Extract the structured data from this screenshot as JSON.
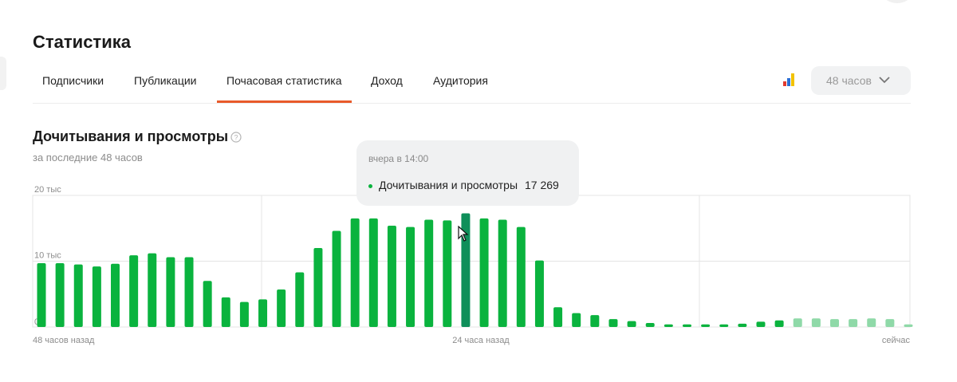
{
  "page": {
    "title": "Статистика"
  },
  "tabs": [
    {
      "label": "Подписчики",
      "active": false
    },
    {
      "label": "Публикации",
      "active": false
    },
    {
      "label": "Почасовая статистика",
      "active": true
    },
    {
      "label": "Доход",
      "active": false
    },
    {
      "label": "Аудитория",
      "active": false
    }
  ],
  "period_select": {
    "value": "48 часов",
    "icon": "chevron-down-icon"
  },
  "stats_icon": "bar-chart-icon",
  "section": {
    "title": "Дочитывания и просмотры",
    "subtitle": "за последние 48 часов",
    "help_icon": "question-circle-icon"
  },
  "tooltip": {
    "time": "вчера в 14:00",
    "series_name": "Дочитывания и просмотры",
    "value": "17 269"
  },
  "colors": {
    "bar": "#0ab33e",
    "bar_active": "#0f8f5a",
    "bar_faded": "#8fd9a8",
    "accent": "#e85a2a"
  },
  "chart_data": {
    "type": "bar",
    "series": [
      {
        "name": "Дочитывания и просмотры",
        "values": [
          9700,
          9700,
          9500,
          9200,
          9600,
          10900,
          11200,
          10600,
          10600,
          7000,
          4500,
          3800,
          4200,
          5700,
          8300,
          12000,
          14600,
          16500,
          16500,
          15400,
          15200,
          16300,
          16200,
          17269,
          16500,
          16300,
          15200,
          10100,
          3000,
          2100,
          1800,
          1200,
          900,
          600,
          400,
          400,
          400,
          400,
          500,
          800,
          1000,
          1300,
          1300,
          1200,
          1200,
          1300,
          1200,
          400
        ],
        "faded_from_index": 41
      }
    ],
    "highlight_index": 23,
    "y_ticks": [
      "20 тыс",
      "10 тыс",
      "0"
    ],
    "y_tick_values": [
      20000,
      10000,
      0
    ],
    "ylim": [
      0,
      20000
    ],
    "x_labels": [
      "48 часов назад",
      "24 часа назад",
      "сейчас"
    ],
    "grid": true
  }
}
